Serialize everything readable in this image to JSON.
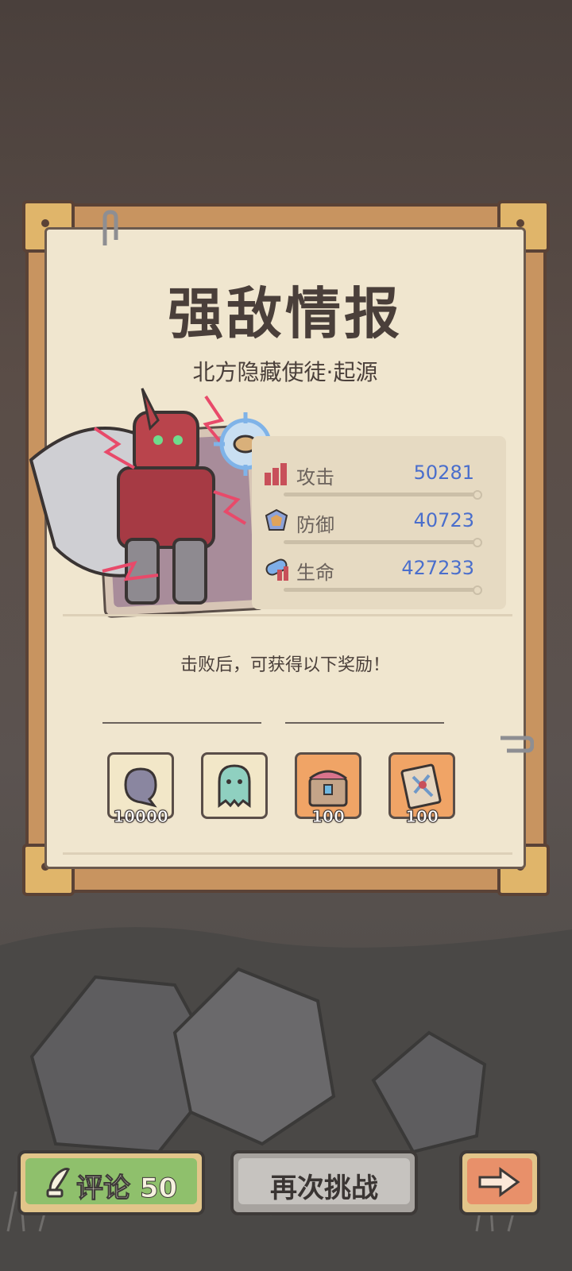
{
  "panel": {
    "title": "强敌情报",
    "subtitle": "北方隐藏使徒·起源"
  },
  "stats": [
    {
      "label": "攻击",
      "value": "50281",
      "icon": "attack-stat-icon"
    },
    {
      "label": "防御",
      "value": "40723",
      "icon": "defense-stat-icon"
    },
    {
      "label": "生命",
      "value": "427233",
      "icon": "health-stat-icon"
    }
  ],
  "rewards": {
    "caption": "击败后，可获得以下奖励！",
    "items": [
      {
        "icon": "purple-soul-icon",
        "count": "10000"
      },
      {
        "icon": "green-ghost-icon",
        "count": ""
      },
      {
        "icon": "treasure-chest-icon",
        "count": "100"
      },
      {
        "icon": "blueprint-scroll-icon",
        "count": "100"
      }
    ]
  },
  "buttons": {
    "comment": "评论 50",
    "retry": "再次挑战",
    "next_icon": "arrow-right-icon"
  },
  "colors": {
    "stat_value": "#4a6ecc",
    "comment_button": "#8fc06c",
    "next_button": "#e8906a"
  }
}
